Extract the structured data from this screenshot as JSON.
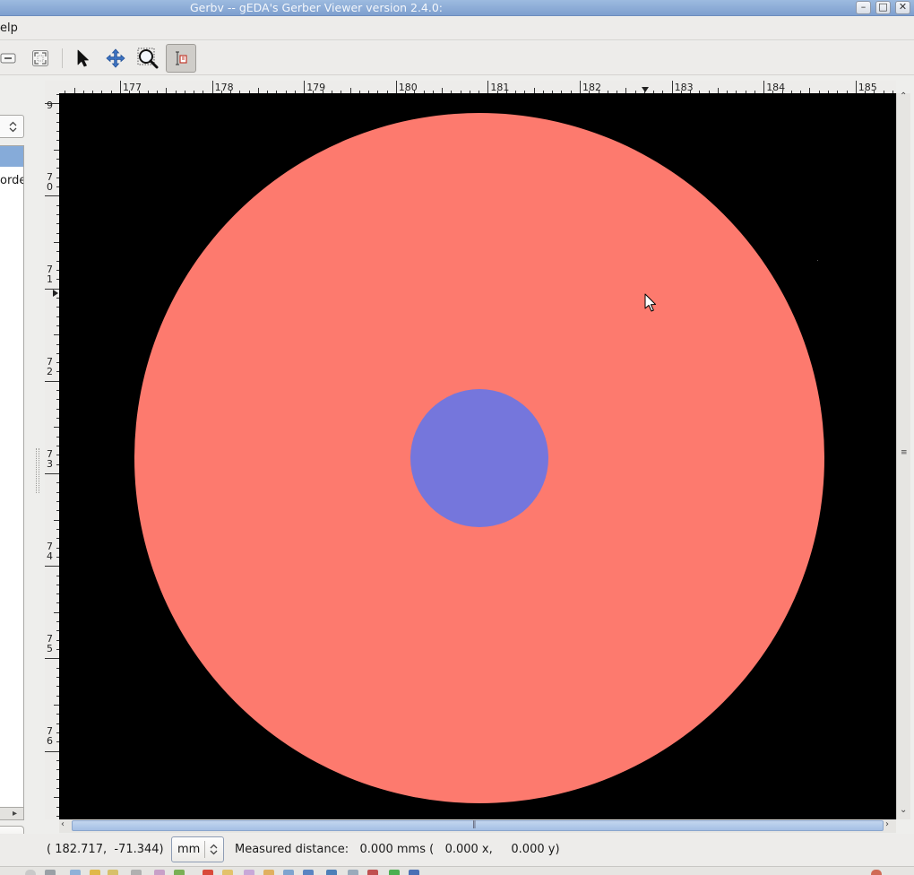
{
  "window": {
    "title": "Gerbv -- gEDA's Gerber Viewer version 2.4.0:",
    "buttons": [
      "minimize",
      "maximize",
      "close"
    ]
  },
  "menubar": {
    "visible_item": "elp"
  },
  "toolbar": {
    "tools": [
      {
        "name": "pointer-tool-icon",
        "active": false
      },
      {
        "name": "pan-tool-icon",
        "active": false
      },
      {
        "name": "zoom-tool-icon",
        "active": false
      },
      {
        "name": "measure-tool-icon",
        "active": true
      }
    ]
  },
  "left_panel": {
    "layer_item_text": "orde"
  },
  "rulers": {
    "horizontal_labels": [
      "177",
      "178",
      "179",
      "180",
      "181",
      "182",
      "183",
      "184",
      "185"
    ],
    "vertical_labels": [
      {
        "top": "",
        "bottom": "9"
      },
      {
        "top": "7",
        "bottom": "0"
      },
      {
        "top": "7",
        "bottom": "1"
      },
      {
        "top": "7",
        "bottom": "2"
      },
      {
        "top": "7",
        "bottom": "3"
      },
      {
        "top": "7",
        "bottom": "4"
      },
      {
        "top": "7",
        "bottom": "5"
      },
      {
        "top": "7",
        "bottom": "6"
      }
    ]
  },
  "colors": {
    "canvas_bg": "#000000",
    "outer_pad": "#fd7a6e",
    "inner_pad": "#7576dc",
    "selection": "#86abd9"
  },
  "statusbar": {
    "coordinates": "( 182.717,  -71.344)",
    "unit": "mm",
    "measured_label": "Measured distance:",
    "measured_value": "0.000 mms (   0.000 x,     0.000 y)"
  }
}
